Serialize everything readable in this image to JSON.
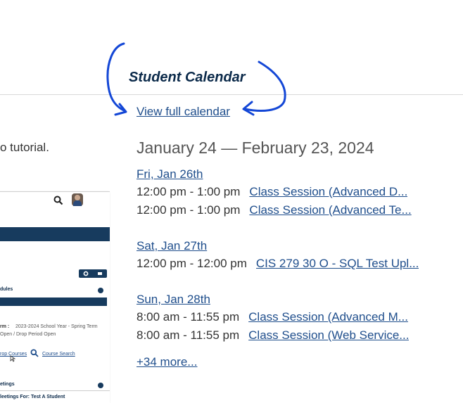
{
  "calendar": {
    "title": "Student Calendar",
    "view_full_label": "View full calendar",
    "date_range": "January 24 — February 23, 2024",
    "days": [
      {
        "label": "Fri, Jan 26th",
        "events": [
          {
            "time": "12:00 pm - 1:00 pm",
            "title": "Class Session (Advanced D..."
          },
          {
            "time": "12:00 pm - 1:00 pm",
            "title": "Class Session (Advanced Te..."
          }
        ]
      },
      {
        "label": "Sat, Jan 27th",
        "events": [
          {
            "time": "12:00 pm - 12:00 pm",
            "title": "CIS 279 30 O - SQL Test Upl..."
          }
        ]
      },
      {
        "label": "Sun, Jan 28th",
        "events": [
          {
            "time": "8:00 am - 11:55 pm",
            "title": "Class Session (Advanced M..."
          },
          {
            "time": "8:00 am - 11:55 pm",
            "title": "Class Session (Web Service..."
          }
        ]
      }
    ],
    "more_label": "+34 more..."
  },
  "left": {
    "tutorial_text": "o tutorial."
  },
  "thumbnail": {
    "schedules_label": "dules",
    "term_label": "rm :",
    "term_value": "2023-2024 School Year - Spring Term",
    "period_text": "Open / Drop Period Open",
    "drop_courses": "rop Courses",
    "course_search": "Course Search",
    "meetings_label": "etings",
    "meetings_for": "leetings For: Test A Student"
  },
  "colors": {
    "title": "#0b2a4a",
    "link": "#1f4e8c",
    "annotation": "#1447d6",
    "nav_bar": "#173b5e"
  }
}
